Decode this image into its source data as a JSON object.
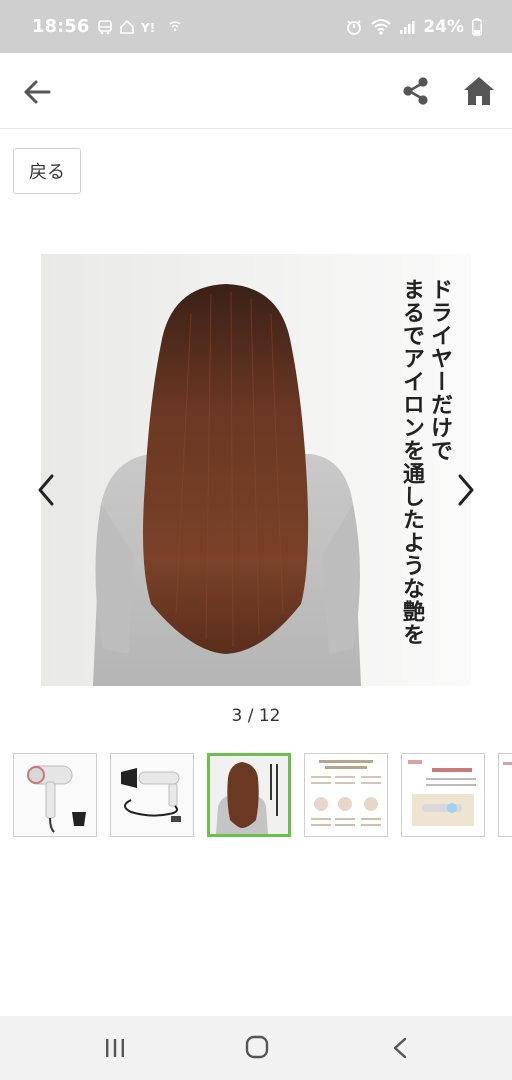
{
  "status_bar": {
    "time": "18:56",
    "battery": "24%"
  },
  "app_bar": {
    "back_icon": "arrow-left-icon",
    "share_icon": "share-icon",
    "home_icon": "home-icon"
  },
  "back_button": {
    "label": "戻る"
  },
  "gallery": {
    "overlay_lines": [
      "ドライヤーだけで",
      "まるでアイロンを通したような艶を"
    ],
    "counter": "3 / 12",
    "current_index": 3,
    "total": 12
  },
  "colors": {
    "accent_green": "#6bbf4b",
    "status_bar_bg": "#cfcfcf"
  }
}
